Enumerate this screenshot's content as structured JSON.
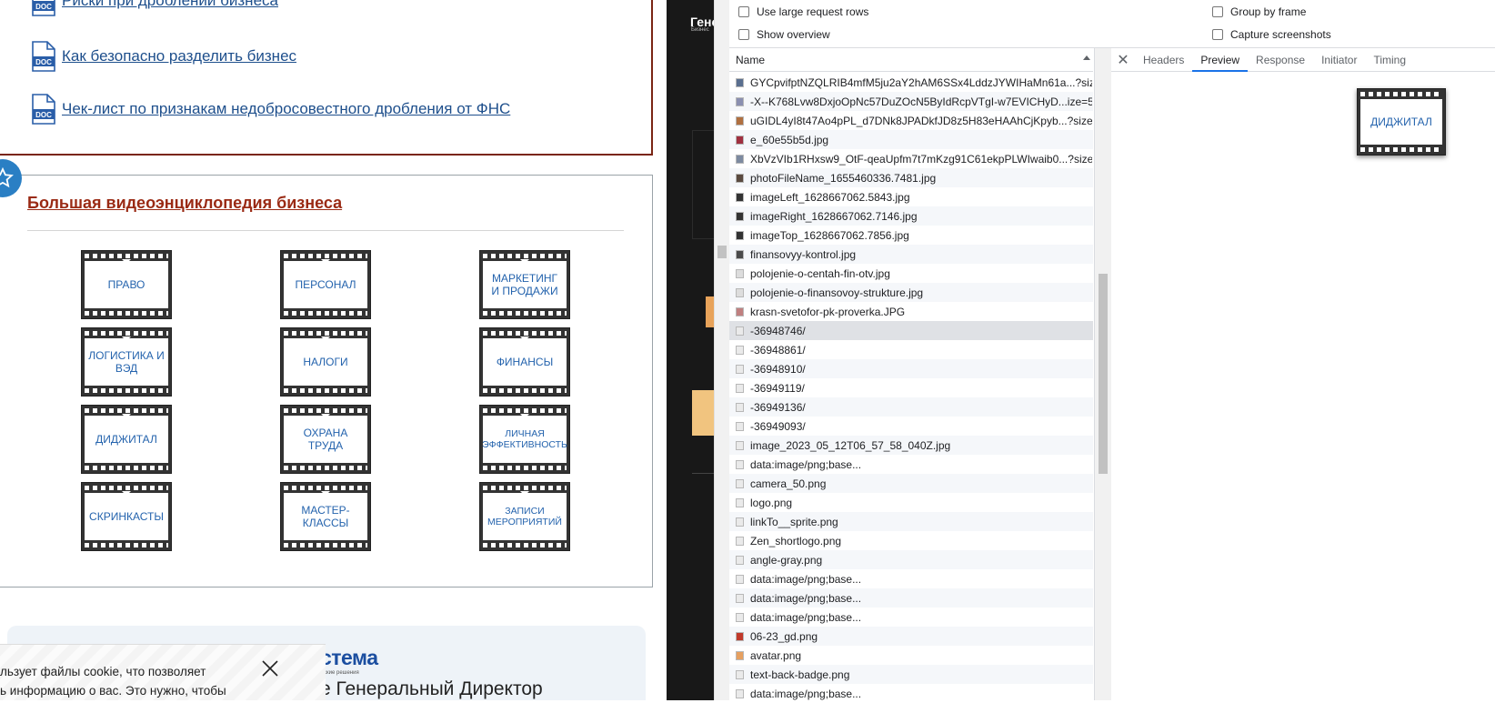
{
  "page": {
    "doc_links": [
      {
        "label": "Риски при дроблении бизнеса",
        "icon": "doc-file-icon"
      },
      {
        "label": "Как безопасно разделить бизнес",
        "icon": "doc-file-icon"
      },
      {
        "label": "Чек-лист по признакам недобросовестного дробления от ФНС",
        "icon": "doc-file-icon"
      }
    ],
    "doc_icon_label": "DOC",
    "encyclopedia": {
      "title": "Большая видеоэнциклопедия бизнеса",
      "tiles": [
        "ПРАВО",
        "ПЕРСОНАЛ",
        "МАРКЕТИНГ И ПРОДАЖИ",
        "ЛОГИСТИКА И ВЭД",
        "НАЛОГИ",
        "ФИНАНСЫ",
        "ДИДЖИТАЛ",
        "ОХРАНА ТРУДА",
        "ЛИЧНАЯ ЭФФЕКТИВНОСТЬ",
        "СКРИНКАСТЫ",
        "МАСТЕР-КЛАССЫ",
        "ЗАПИСИ МЕРОПРИЯТИЙ"
      ]
    },
    "promo": {
      "logo": "стема",
      "sub": "ские решения",
      "title": "е Генеральный Директор"
    },
    "cookie": {
      "line1": "льзует файлы cookie, что позволяет",
      "line2": "ь информацию о вас. Это нужно, чтобы"
    },
    "dark_panel": {
      "brand": "Гене",
      "brand_sub": "Бизнес"
    }
  },
  "devtools": {
    "options": {
      "large_rows": "Use large request rows",
      "overview": "Show overview",
      "group_by_frame": "Group by frame",
      "capture_screenshots": "Capture screenshots"
    },
    "column_name": "Name",
    "requests": [
      "GYCpvifptNZQLRIB4mfM5ju2aY2hAM6SSx4LddzJYWIHaMn61a...?size...",
      "-X--K768Lvw8DxjoOpNc57DuZOcN5ByIdRcpVTgI-w7EVICHyD...ize=5...",
      "uGIDL4yI8t47Ao4pPL_d7DNk8JPADkfJD8z5H83eHAAhCjKpyb...?size=...",
      "e_60e55b5d.jpg",
      "XbVzVIb1RHxsw9_OtF-qeaUpfm7t7mKzg91C61ekpPLWIwaib0...?size...",
      "photoFileName_1655460336.7481.jpg",
      "imageLeft_1628667062.5843.jpg",
      "imageRight_1628667062.7146.jpg",
      "imageTop_1628667062.7856.jpg",
      "finansovyy-kontrol.jpg",
      "polojenie-o-centah-fin-otv.jpg",
      "polojenie-o-finansovoy-strukture.jpg",
      "krasn-svetofor-pk-proverka.JPG",
      "-36948746/",
      "-36948861/",
      "-36948910/",
      "-36949119/",
      "-36949136/",
      "-36949093/",
      "image_2023_05_12T06_57_58_040Z.jpg",
      "data:image/png;base...",
      "camera_50.png",
      "logo.png",
      "linkTo__sprite.png",
      "Zen_shortlogo.png",
      "angle-gray.png",
      "data:image/png;base...",
      "data:image/png;base...",
      "data:image/png;base...",
      "06-23_gd.png",
      "avatar.png",
      "text-back-badge.png",
      "data:image/png;base..."
    ],
    "tabs": [
      "Headers",
      "Preview",
      "Response",
      "Initiator",
      "Timing"
    ],
    "active_tab": "Preview",
    "preview_label": "ДИДЖИТАЛ"
  }
}
